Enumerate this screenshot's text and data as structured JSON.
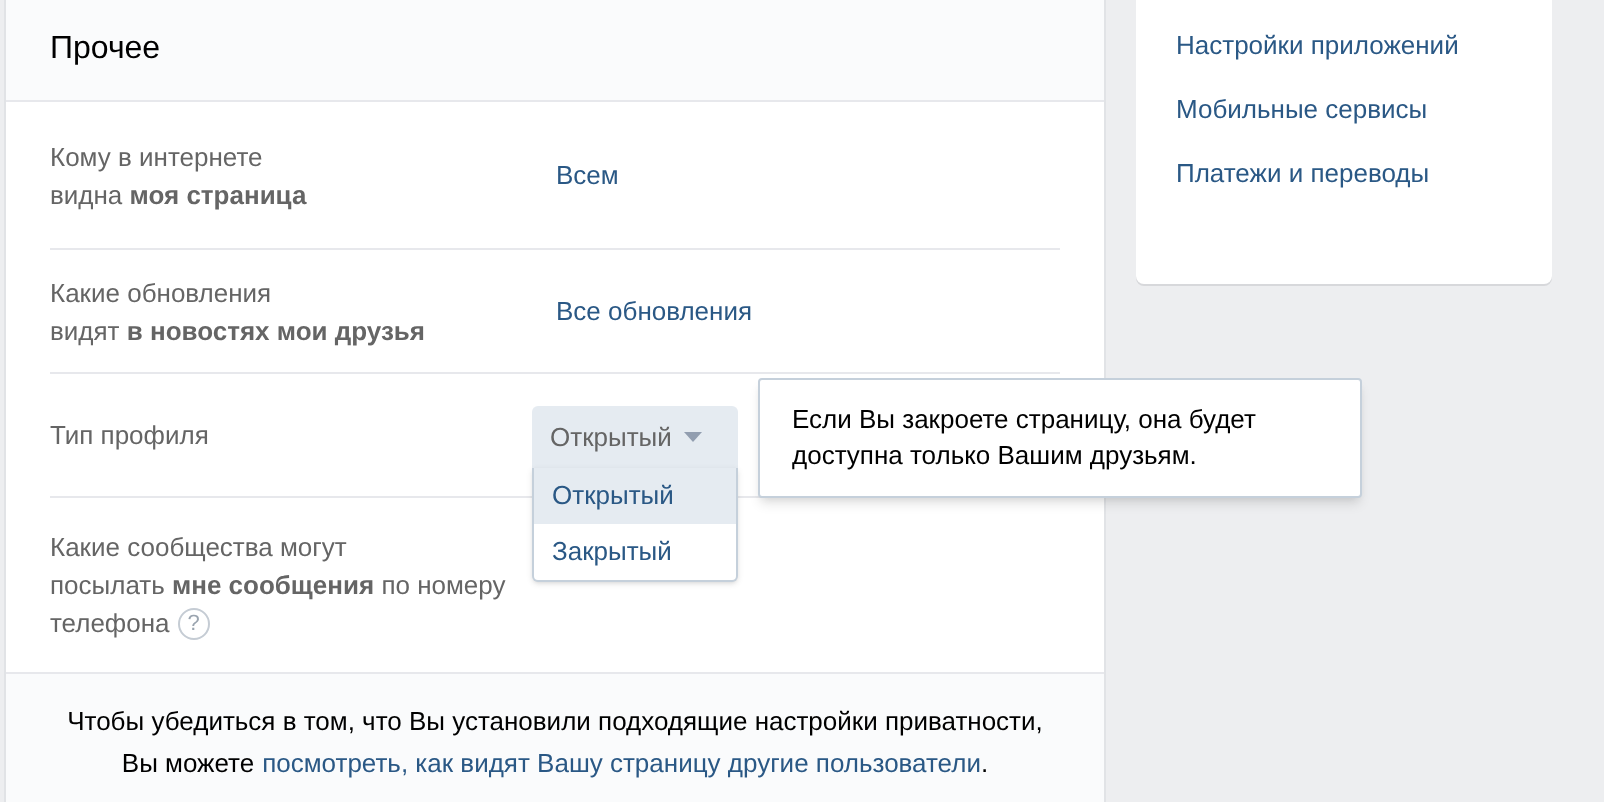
{
  "section": {
    "title": "Прочее"
  },
  "rows": [
    {
      "kind": "link",
      "label": "Кому в интернете\nвидна **моя страница**",
      "value": "Всем"
    },
    {
      "kind": "link",
      "label": "Какие обновления\nвидят **в новостях мои друзья**",
      "value": "Все обновления"
    },
    {
      "kind": "dropdown",
      "label": "Тип профиля",
      "value": "Открытый",
      "expanded": true,
      "options": [
        {
          "label": "Открытый",
          "selected": true
        },
        {
          "label": "Закрытый",
          "selected": false
        }
      ],
      "tooltip": "Если Вы закроете страницу, она будет\nдоступна только Вашим друзьям."
    },
    {
      "kind": "plain",
      "label": "Какие сообщества могут\nпосылать **мне сообщения** по номеру\nтелефона",
      "help": "?"
    }
  ],
  "footer": {
    "text": "Чтобы убедиться в том, что Вы установили подходящие настройки приватности,",
    "text2": "Вы можете",
    "link": "посмотреть, как видят Вашу страницу другие пользователи",
    "end": "."
  },
  "sidebar": {
    "items": [
      "Настройки приложений",
      "Мобильные сервисы",
      "Платежи и переводы"
    ]
  }
}
